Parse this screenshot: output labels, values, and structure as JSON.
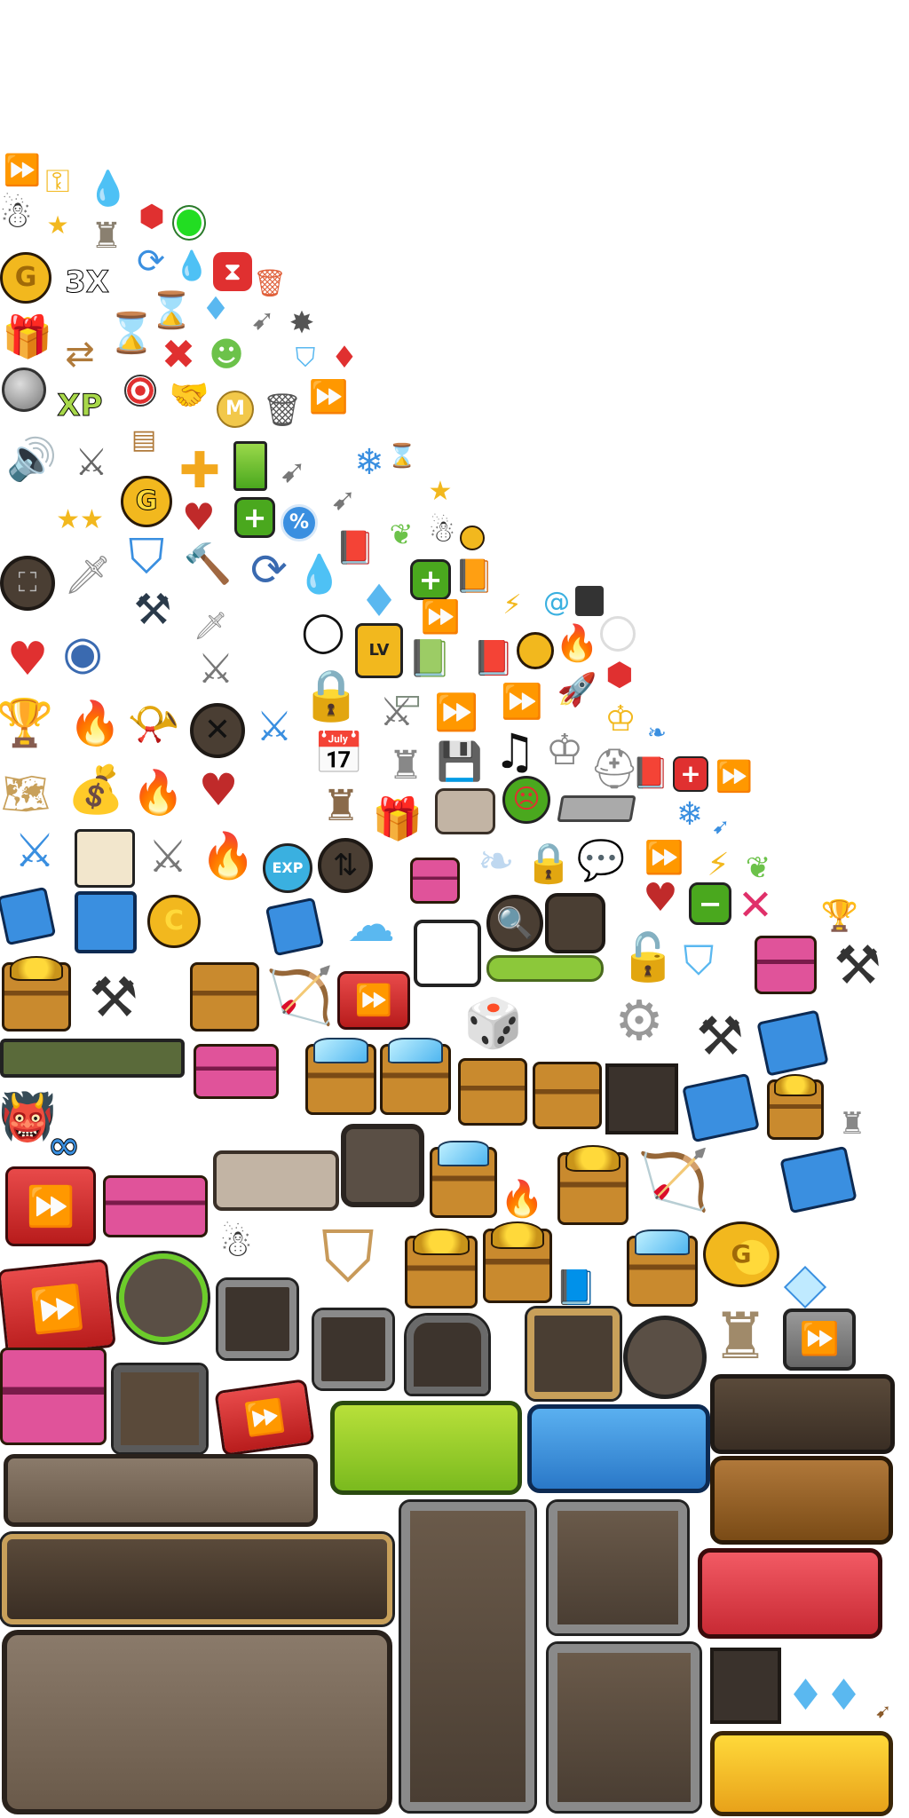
{
  "sheet": {
    "background": "#ffffff",
    "labels": {
      "triple": "3X",
      "xp": "XP",
      "lv": "LV",
      "exp": "EXP",
      "m": "M",
      "g": "G",
      "c": "C",
      "percent": "%",
      "infinity": "∞"
    }
  },
  "colors": {
    "button_green": "#9acd32",
    "button_blue": "#3a8fe0",
    "button_red": "#e8404a",
    "button_yellow": "#f5b820",
    "button_brown": "#8a5a2a",
    "panel_dark": "#3d342d",
    "panel_stone": "#8a8a8a",
    "gem_blue": "#5ab8f0",
    "gold": "#f2b81e",
    "red": "#e03030"
  },
  "icons": [
    "fast-forward-icon",
    "key-icon",
    "water-drop-icon",
    "stick-figure-icon",
    "star-icon",
    "tower-icon",
    "red-gem-icon",
    "green-dot-icon",
    "gold-coin-plus-icon",
    "refresh-icon",
    "poison-drop-icon",
    "hourglass-badge-icon",
    "trash-icon",
    "gift-box-icon",
    "hourglass-icon",
    "diamond-icon",
    "arrow-icon",
    "spiky-star-icon",
    "swap-arrows-icon",
    "cross-icon",
    "goblin-icon",
    "shield-icon",
    "ruby-icon",
    "magnifier-icon",
    "xp-plus-icon",
    "target-icon",
    "handshake-icon",
    "m-badge-icon",
    "speaker-icon",
    "crossed-swords-icon",
    "plus-icon",
    "battery-icon",
    "snowflake-icon",
    "lock-icon",
    "trophy-icon",
    "pouch-icon",
    "heart-icon",
    "settings-gear-icon",
    "dice-icon",
    "floppy-disk-icon",
    "music-note-icon",
    "calendar-icon",
    "checklist-icon",
    "cards-icon",
    "cloud-download-icon",
    "bow-icon",
    "anvil-icon",
    "crown-icon",
    "wing-icon",
    "chat-icon"
  ]
}
